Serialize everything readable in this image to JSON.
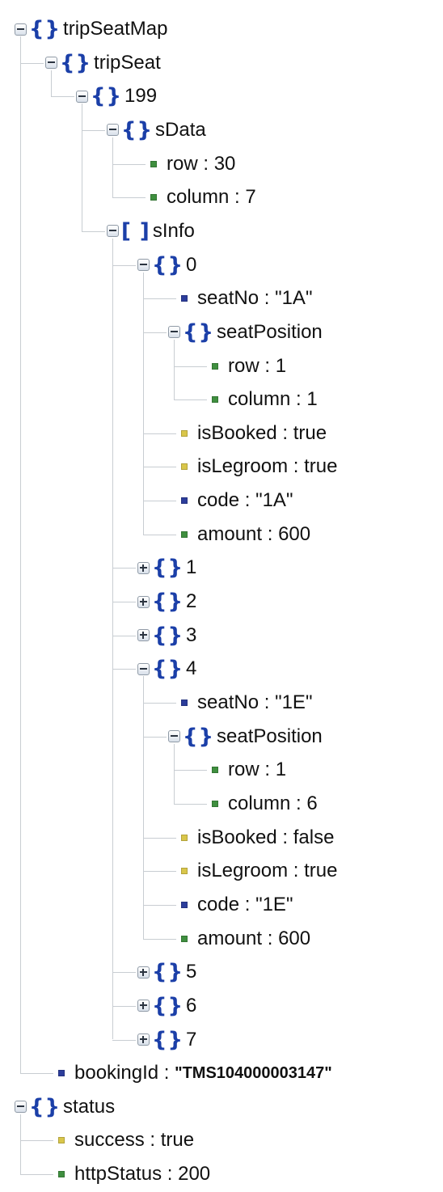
{
  "colors": {
    "bracket": "#1b3fa8",
    "toggle_border": "#8f9aa6",
    "toggle_fill": "#dfe6ee",
    "toggle_mark": "#2b3440",
    "connector": "#c8cdd2",
    "object_icon": "#1b3fa8",
    "number_icon": "#3f8f3f",
    "string_icon": "#2c3d9b",
    "boolean_icon": "#d9c64a",
    "text": "#111111"
  },
  "tree": [
    {
      "kind": "object",
      "key": "tripSeatMap",
      "expanded": true,
      "depth": 0
    },
    {
      "kind": "object",
      "key": "tripSeat",
      "expanded": true,
      "depth": 1
    },
    {
      "kind": "object",
      "key": "199",
      "expanded": true,
      "depth": 2
    },
    {
      "kind": "object",
      "key": "sData",
      "expanded": true,
      "depth": 3
    },
    {
      "kind": "number",
      "key": "row",
      "value": "30",
      "depth": 4
    },
    {
      "kind": "number",
      "key": "column",
      "value": "7",
      "depth": 4
    },
    {
      "kind": "array",
      "key": "sInfo",
      "expanded": true,
      "depth": 3
    },
    {
      "kind": "object",
      "key": "0",
      "expanded": true,
      "depth": 4
    },
    {
      "kind": "string",
      "key": "seatNo",
      "value": "\"1A\"",
      "depth": 5
    },
    {
      "kind": "object",
      "key": "seatPosition",
      "expanded": true,
      "depth": 5
    },
    {
      "kind": "number",
      "key": "row",
      "value": "1",
      "depth": 6
    },
    {
      "kind": "number",
      "key": "column",
      "value": "1",
      "depth": 6
    },
    {
      "kind": "boolean",
      "key": "isBooked",
      "value": "true",
      "depth": 5
    },
    {
      "kind": "boolean",
      "key": "isLegroom",
      "value": "true",
      "depth": 5
    },
    {
      "kind": "string",
      "key": "code",
      "value": "\"1A\"",
      "depth": 5
    },
    {
      "kind": "number",
      "key": "amount",
      "value": "600",
      "depth": 5
    },
    {
      "kind": "object",
      "key": "1",
      "expanded": false,
      "depth": 4
    },
    {
      "kind": "object",
      "key": "2",
      "expanded": false,
      "depth": 4
    },
    {
      "kind": "object",
      "key": "3",
      "expanded": false,
      "depth": 4
    },
    {
      "kind": "object",
      "key": "4",
      "expanded": true,
      "depth": 4
    },
    {
      "kind": "string",
      "key": "seatNo",
      "value": "\"1E\"",
      "depth": 5
    },
    {
      "kind": "object",
      "key": "seatPosition",
      "expanded": true,
      "depth": 5
    },
    {
      "kind": "number",
      "key": "row",
      "value": "1",
      "depth": 6
    },
    {
      "kind": "number",
      "key": "column",
      "value": "6",
      "depth": 6
    },
    {
      "kind": "boolean",
      "key": "isBooked",
      "value": "false",
      "depth": 5
    },
    {
      "kind": "boolean",
      "key": "isLegroom",
      "value": "true",
      "depth": 5
    },
    {
      "kind": "string",
      "key": "code",
      "value": "\"1E\"",
      "depth": 5
    },
    {
      "kind": "number",
      "key": "amount",
      "value": "600",
      "depth": 5
    },
    {
      "kind": "object",
      "key": "5",
      "expanded": false,
      "depth": 4
    },
    {
      "kind": "object",
      "key": "6",
      "expanded": false,
      "depth": 4
    },
    {
      "kind": "object",
      "key": "7",
      "expanded": false,
      "depth": 4
    },
    {
      "kind": "string",
      "key": "bookingId",
      "value": "\"TMS104000003147\"",
      "depth": 1,
      "value_strong": true
    },
    {
      "kind": "object",
      "key": "status",
      "expanded": true,
      "depth": 0
    },
    {
      "kind": "boolean",
      "key": "success",
      "value": "true",
      "depth": 1
    },
    {
      "kind": "number",
      "key": "httpStatus",
      "value": "200",
      "depth": 1
    }
  ]
}
